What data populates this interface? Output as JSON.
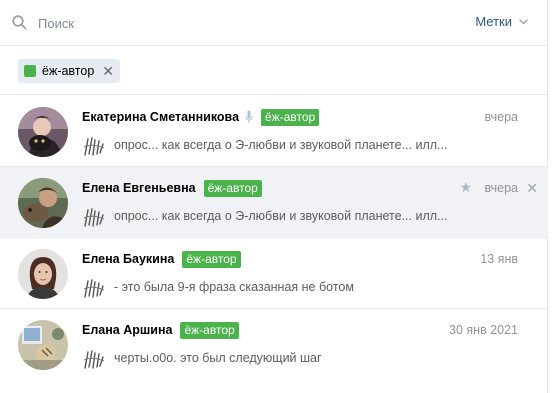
{
  "search": {
    "placeholder": "Поиск"
  },
  "labels_button": "Метки",
  "filter_chip": {
    "label": "ёж-автор",
    "color": "#4bb34b"
  },
  "conversations": [
    {
      "name": "Екатерина Сметанникова",
      "tag": "ёж-автор",
      "date": "вчера",
      "preview": "опрос... как всегда о Э-любви и звуковой планете... илл...",
      "muted": true,
      "selected": false,
      "avatar": "woman-with-cat-avatar"
    },
    {
      "name": "Елена Евгеньевна",
      "tag": "ёж-автор",
      "date": "вчера",
      "preview": "опрос... как всегда о Э-любви и звуковой планете... илл...",
      "muted": false,
      "selected": true,
      "avatar": "woman-with-dog-avatar"
    },
    {
      "name": "Елена Баукина",
      "tag": "ёж-автор",
      "date": "13 янв",
      "preview": "- это была 9-я фраза сказанная не ботом",
      "muted": false,
      "selected": false,
      "avatar": "woman-portrait-avatar"
    },
    {
      "name": "Елана Аршина",
      "tag": "ёж-автор",
      "date": "30 янв 2021",
      "preview": "черты.о0о. это был следующий шаг",
      "muted": false,
      "selected": false,
      "avatar": "desk-photo-avatar"
    }
  ],
  "colors": {
    "accent": "#2a5885",
    "tag_green": "#4bb34b",
    "selected_bg": "#f0f2f5"
  }
}
